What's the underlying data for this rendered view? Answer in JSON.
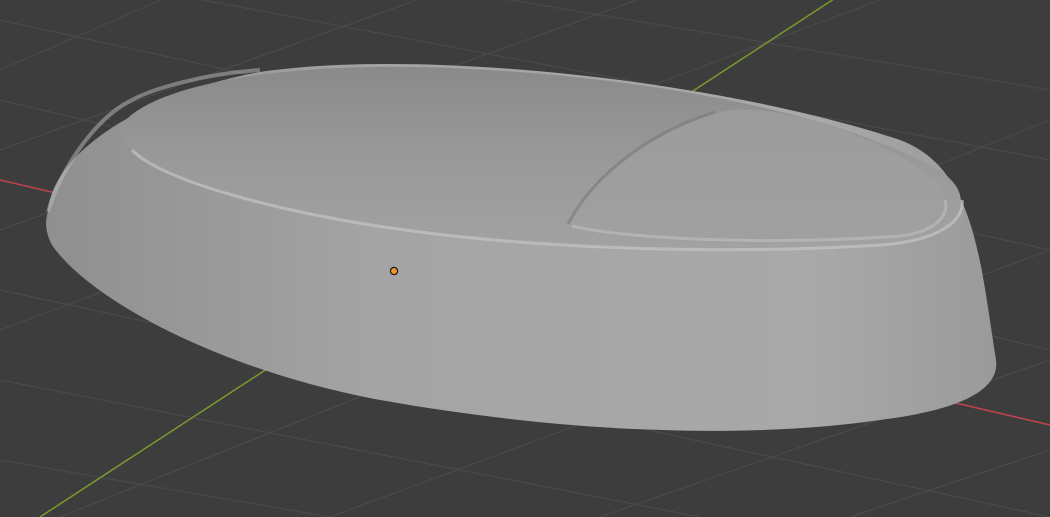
{
  "viewport": {
    "background_color": "#3d3d3d",
    "grid_line_color": "#4a4a4a",
    "x_axis_color": "#c0444c",
    "y_axis_color": "#7a9a2e",
    "object_color": "#a6a6a6",
    "origin_marker_color": "#f0952a",
    "object_kind": "mesh-object",
    "selected": true
  }
}
